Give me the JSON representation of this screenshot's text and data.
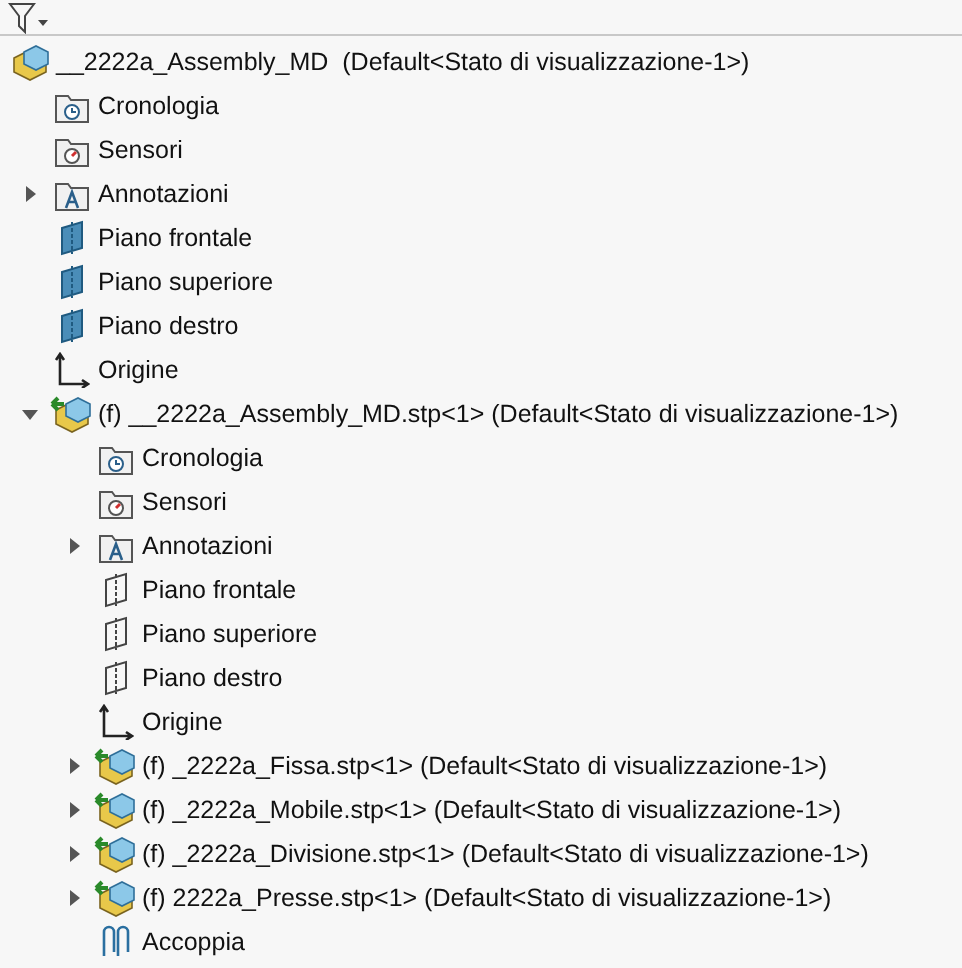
{
  "tree": {
    "label": "__2222a_Assembly_MD  (Default<Stato di visualizzazione-1>)",
    "kind": "assembly",
    "children": [
      {
        "label": "Cronologia",
        "kind": "history"
      },
      {
        "label": "Sensori",
        "kind": "sensors"
      },
      {
        "label": "Annotazioni",
        "kind": "annotations",
        "expanded": false
      },
      {
        "label": "Piano frontale",
        "kind": "plane"
      },
      {
        "label": "Piano superiore",
        "kind": "plane"
      },
      {
        "label": "Piano destro",
        "kind": "plane"
      },
      {
        "label": "Origine",
        "kind": "origin"
      },
      {
        "label": "(f) __2222a_Assembly_MD.stp<1> (Default<Stato di visualizzazione-1>)",
        "kind": "subassembly",
        "expanded": true,
        "children": [
          {
            "label": "Cronologia",
            "kind": "history"
          },
          {
            "label": "Sensori",
            "kind": "sensors"
          },
          {
            "label": "Annotazioni",
            "kind": "annotations",
            "expanded": false
          },
          {
            "label": "Piano frontale",
            "kind": "plane-outline"
          },
          {
            "label": "Piano superiore",
            "kind": "plane-outline"
          },
          {
            "label": "Piano destro",
            "kind": "plane-outline"
          },
          {
            "label": "Origine",
            "kind": "origin"
          },
          {
            "label": "(f) _2222a_Fissa.stp<1> (Default<Stato di visualizzazione-1>)",
            "kind": "subassembly",
            "expanded": false
          },
          {
            "label": "(f) _2222a_Mobile.stp<1> (Default<Stato di visualizzazione-1>)",
            "kind": "subassembly",
            "expanded": false
          },
          {
            "label": "(f) _2222a_Divisione.stp<1> (Default<Stato di visualizzazione-1>)",
            "kind": "subassembly",
            "expanded": false
          },
          {
            "label": "(f) 2222a_Presse.stp<1> (Default<Stato di visualizzazione-1>)",
            "kind": "subassembly",
            "expanded": false
          },
          {
            "label": "Accoppia",
            "kind": "mates"
          }
        ]
      }
    ]
  }
}
